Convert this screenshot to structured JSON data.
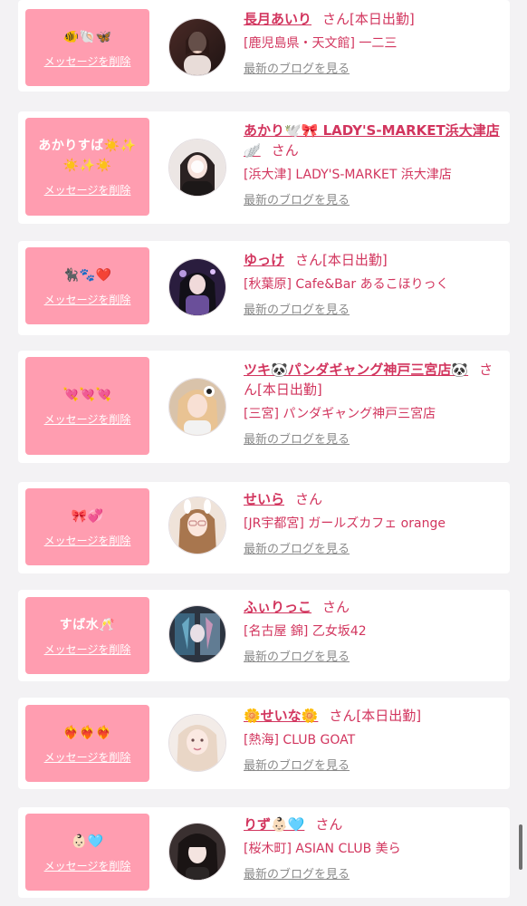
{
  "delete_label": "メッセージを削除",
  "blog_label": "最新のブログを見る",
  "san_label": "さん",
  "colors": {
    "accent_pink": "#ff9db0",
    "text_pink": "#d2355e",
    "muted": "#8a8a8a",
    "background": "#f3f2f4"
  },
  "entries": [
    {
      "message": "🐠🐚🦋",
      "name": "長月あいり",
      "status": "[本日出勤]",
      "shop": "[鹿児島県・天文館] 一二三"
    },
    {
      "message": "あかりすば☀️✨☀️✨☀️",
      "name": "あかり🕊️🎀 LADY'S-MARKET浜大津店🪽",
      "status": "",
      "shop": "[浜大津] LADY'S-MARKET 浜大津店"
    },
    {
      "message": "🐈‍⬛🐾❤️",
      "name": "ゆっけ",
      "status": "[本日出勤]",
      "shop": "[秋葉原] Cafe&Bar あるこほりっく"
    },
    {
      "message": "💘💘💘",
      "name": "ツキ🐼パンダギャング神戸三宮店🐼",
      "status": "[本日出勤]",
      "shop": "[三宮] パンダギャング神戸三宮店"
    },
    {
      "message": "🎀💞",
      "name": "せいら",
      "status": "",
      "shop": "[JR宇都宮] ガールズカフェ orange"
    },
    {
      "message": "すば水🥂",
      "name": "ふぃりっこ",
      "status": "",
      "shop": "[名古屋 錦] 乙女坂42"
    },
    {
      "message": "❤️‍🔥❤️‍🔥❤️‍🔥",
      "name": "🌼せいな🌼",
      "status": "[本日出勤]",
      "shop": "[熱海] CLUB GOAT"
    },
    {
      "message": "👶🏻🩵",
      "name": "りず👶🏻🩵",
      "status": "",
      "shop": "[桜木町] ASIAN CLUB 美ら"
    }
  ]
}
